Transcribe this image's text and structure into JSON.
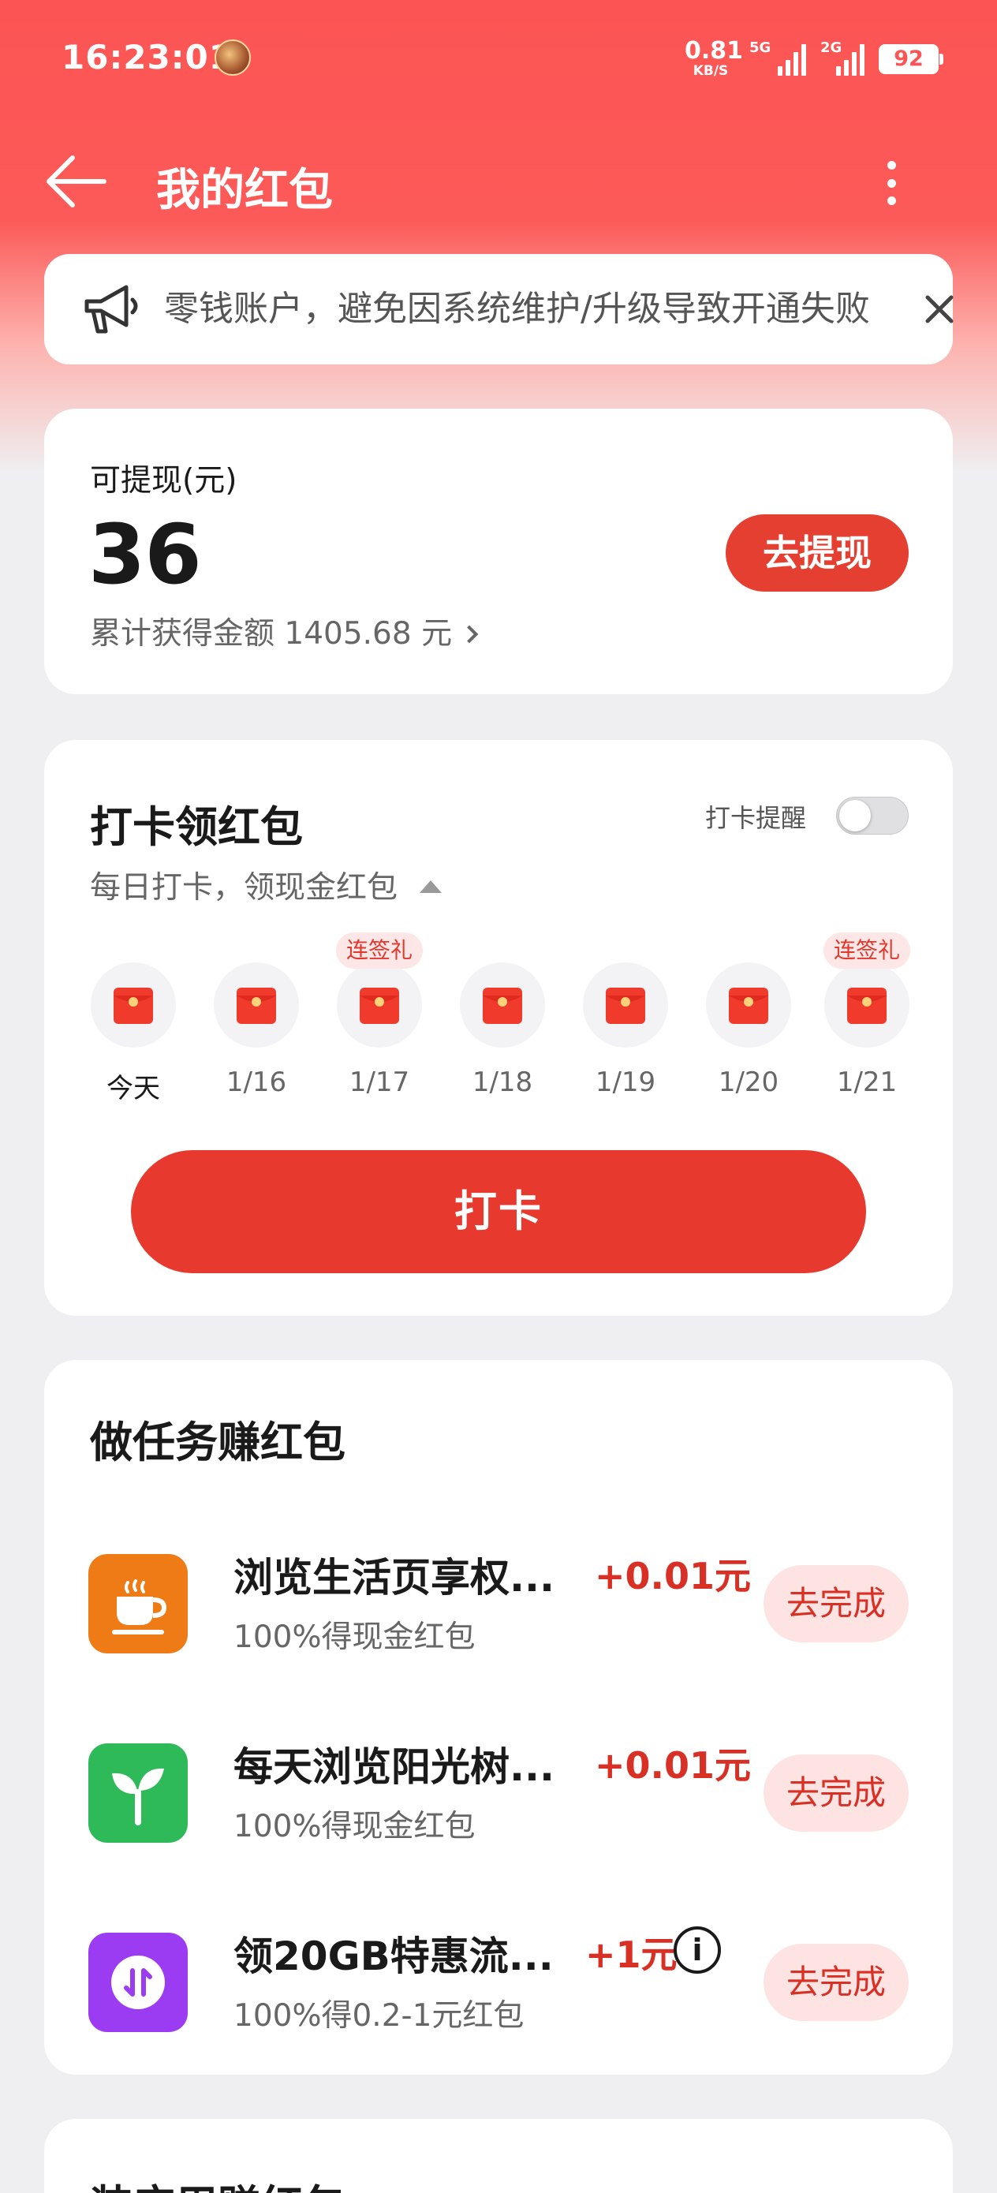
{
  "status_bar": {
    "time": "16:23:01",
    "net_speed_value": "0.81",
    "net_speed_unit": "KB/S",
    "sim1_tag": "5G",
    "sim2_tag": "2G",
    "battery": "92"
  },
  "header": {
    "title": "我的红包"
  },
  "notice": {
    "text": "零钱账户，避免因系统维护/升级导致开通失败"
  },
  "withdraw": {
    "label": "可提现(元)",
    "amount": "36",
    "total_text": "累计获得金额 1405.68 元",
    "button": "去提现"
  },
  "checkin": {
    "title": "打卡领红包",
    "subtitle": "每日打卡，领现金红包",
    "remind_label": "打卡提醒",
    "remind_on": false,
    "days": [
      {
        "label": "今天",
        "badge": ""
      },
      {
        "label": "1/16",
        "badge": ""
      },
      {
        "label": "1/17",
        "badge": "连签礼"
      },
      {
        "label": "1/18",
        "badge": ""
      },
      {
        "label": "1/19",
        "badge": ""
      },
      {
        "label": "1/20",
        "badge": ""
      },
      {
        "label": "1/21",
        "badge": "连签礼"
      }
    ],
    "button": "打卡"
  },
  "tasks": {
    "title": "做任务赚红包",
    "items": [
      {
        "icon": "coffee-cup-icon",
        "color": "#ef7b16",
        "name": "浏览生活页享权...",
        "reward": "+0.01元",
        "desc": "100%得现金红包",
        "button": "去完成"
      },
      {
        "icon": "sprout-icon",
        "color": "#2fba5a",
        "name": "每天浏览阳光树...",
        "reward": "+0.01元",
        "desc": "100%得现金红包",
        "button": "去完成"
      },
      {
        "icon": "data-transfer-icon",
        "color": "#9b3bf2",
        "name": "领20GB特惠流...",
        "reward": "+1元",
        "desc": "100%得0.2-1元红包",
        "button": "去完成"
      }
    ]
  },
  "bottom_section": {
    "title": "装应用赚红包"
  },
  "colors": {
    "brand_red": "#fc5454",
    "button_red": "#e8392e",
    "reward_red": "#d93025"
  }
}
